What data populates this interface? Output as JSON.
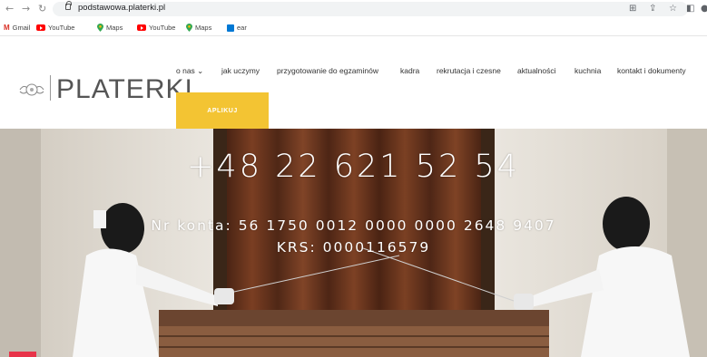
{
  "browser": {
    "url": "podstawowa.platerki.pl",
    "bookmarks": [
      {
        "label": "Gmail",
        "icon": "gmail-icon"
      },
      {
        "label": "YouTube",
        "icon": "youtube-icon"
      },
      {
        "label": "Maps",
        "icon": "maps-icon"
      },
      {
        "label": "YouTube",
        "icon": "youtube-icon"
      },
      {
        "label": "Maps",
        "icon": "maps-icon"
      },
      {
        "label": "ear",
        "icon": "outlook-icon"
      }
    ]
  },
  "site": {
    "logo_text": "PLATERKI",
    "menu": [
      {
        "label": "o nas ⌄"
      },
      {
        "label": "jak uczymy"
      },
      {
        "label": "przygotowanie do egzaminów"
      },
      {
        "label": "kadra"
      },
      {
        "label": "rekrutacja i czesne"
      },
      {
        "label": "aktualności"
      },
      {
        "label": "kuchnia"
      },
      {
        "label": "kontakt i dokumenty"
      }
    ],
    "apply_label": "APLIKUJ"
  },
  "hero": {
    "phone": "+48 22 621 52 54",
    "konto": "Nr konta: 56 1750 0012 0000 0000 2648 9407",
    "krs": "KRS: 0000116579"
  },
  "colors": {
    "accent": "#f3c433",
    "text": "#333333"
  }
}
